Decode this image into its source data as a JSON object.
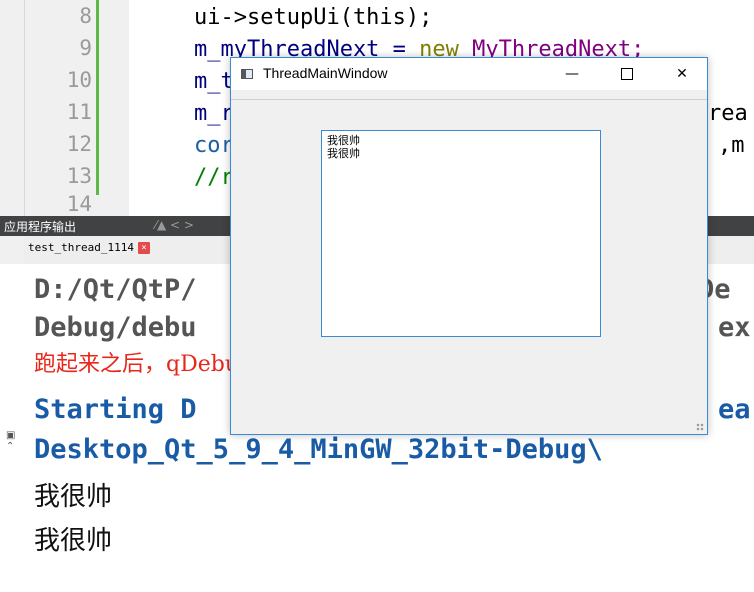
{
  "editor": {
    "line_numbers": [
      "8",
      "9",
      "10",
      "11",
      "12",
      "13",
      "14"
    ],
    "lines": {
      "l8": "ui->setupUi(this);",
      "l9_a": "m_myThreadNext = ",
      "l9_b": "new",
      "l9_c": " MyThreadNext;",
      "l10": "m_t",
      "l11_a": "m_r",
      "l11_b": "rea",
      "l12_a": "cor",
      "l12_b": ",m",
      "l13": "//r"
    }
  },
  "output_pane": {
    "title": "应用程序输出",
    "controls": "⁄▲ < >",
    "tab_label": "test_thread_1114",
    "tab_close": "×",
    "lines": {
      "path1_a": "D:/Qt/QtP/",
      "path1_b": "De",
      "path2_a": "Debug/debu",
      "path2_b": "ex",
      "note": "跑起来之后，qDebug()输出，和文本浏览器同时显示",
      "starting_a": "Starting D",
      "starting_b": "ea",
      "desktop": "Desktop_Qt_5_9_4_MinGW_32bit-Debug\\",
      "out1": "我很帅",
      "out2": "我很帅"
    }
  },
  "window": {
    "title": "ThreadMainWindow",
    "minimize": "—",
    "close": "✕",
    "text_browser_lines": [
      "我很帅",
      "我很帅"
    ]
  },
  "colors": {
    "accent": "#3a8ad6",
    "note_red": "#e8261a",
    "code_navy": "#000080",
    "keyword_olive": "#808000",
    "class_purple": "#800080"
  }
}
